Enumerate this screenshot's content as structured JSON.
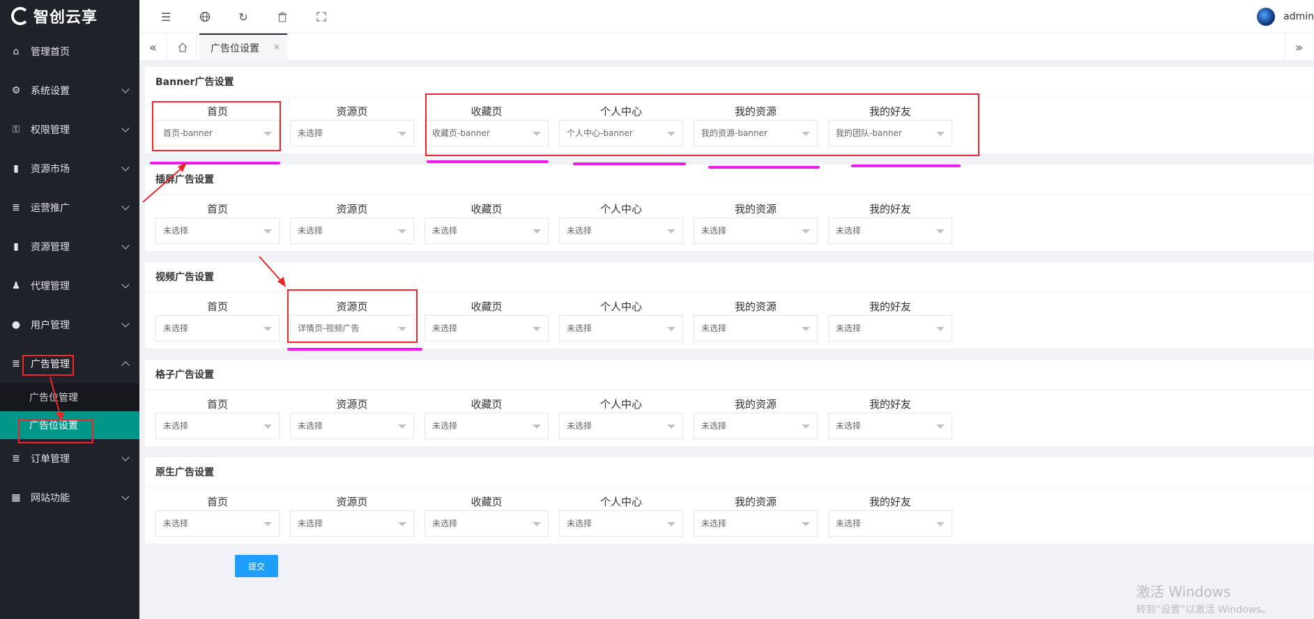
{
  "brand": {
    "name": "智创云享"
  },
  "sidebar": {
    "items": [
      {
        "label": "管理首页",
        "icon": "home-icon",
        "chevron": false
      },
      {
        "label": "系统设置",
        "icon": "gear-icon",
        "chevron": true
      },
      {
        "label": "权限管理",
        "icon": "key-icon",
        "chevron": true
      },
      {
        "label": "资源市场",
        "icon": "book-icon",
        "chevron": true
      },
      {
        "label": "运营推广",
        "icon": "list-icon",
        "chevron": true
      },
      {
        "label": "资源管理",
        "icon": "book-icon",
        "chevron": true
      },
      {
        "label": "代理管理",
        "icon": "users-icon",
        "chevron": true
      },
      {
        "label": "用户管理",
        "icon": "user-icon",
        "chevron": true
      },
      {
        "label": "广告管理",
        "icon": "list-icon",
        "chevron": true,
        "open": true
      },
      {
        "label": "订单管理",
        "icon": "list-icon",
        "chevron": true
      },
      {
        "label": "网站功能",
        "icon": "grid-icon",
        "chevron": true
      }
    ],
    "submenu": [
      {
        "label": "广告位管理"
      },
      {
        "label": "广告位设置",
        "active": true
      }
    ]
  },
  "header": {
    "user": "admin",
    "tools": [
      "indent-icon",
      "globe-icon",
      "refresh-icon",
      "trash-icon",
      "fullscreen-icon"
    ]
  },
  "tabs": {
    "active": "广告位设置",
    "close": "×"
  },
  "columns": [
    "首页",
    "资源页",
    "收藏页",
    "个人中心",
    "我的资源",
    "我的好友"
  ],
  "sections": [
    {
      "title": "Banner广告设置",
      "values": [
        "首页-banner",
        "未选择",
        "收藏页-banner",
        "个人中心-banner",
        "我的资源-banner",
        "我的团队-banner"
      ]
    },
    {
      "title": "插屏广告设置",
      "values": [
        "未选择",
        "未选择",
        "未选择",
        "未选择",
        "未选择",
        "未选择"
      ]
    },
    {
      "title": "视频广告设置",
      "values": [
        "未选择",
        "详情页-视频广告",
        "未选择",
        "未选择",
        "未选择",
        "未选择"
      ]
    },
    {
      "title": "格子广告设置",
      "values": [
        "未选择",
        "未选择",
        "未选择",
        "未选择",
        "未选择",
        "未选择"
      ]
    },
    {
      "title": "原生广告设置",
      "values": [
        "未选择",
        "未选择",
        "未选择",
        "未选择",
        "未选择",
        "未选择"
      ]
    }
  ],
  "submit_label": "提交",
  "watermark": {
    "line1": "激活 Windows",
    "line2": "转到“设置”以激活 Windows。"
  },
  "colors": {
    "sidebar_bg": "#20222a",
    "active_sub": "#009688",
    "submit": "#1e9fff",
    "annotation_red": "#f0262a",
    "annotation_pink": "#ee1aee"
  }
}
